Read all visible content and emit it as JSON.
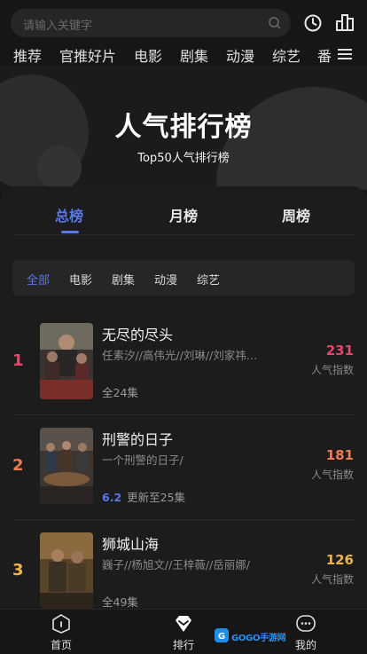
{
  "search": {
    "placeholder": "请输入关键字"
  },
  "nav": {
    "tabs": [
      "推荐",
      "官推好片",
      "电影",
      "剧集",
      "动漫",
      "综艺",
      "番"
    ]
  },
  "banner": {
    "title": "人气排行榜",
    "subtitle": "Top50人气排行榜"
  },
  "period_tabs": [
    "总榜",
    "月榜",
    "周榜"
  ],
  "filters": [
    "全部",
    "电影",
    "剧集",
    "动漫",
    "综艺"
  ],
  "rankings": [
    {
      "rank": "1",
      "title": "无尽的尽头",
      "cast": "任素汐//高伟光//刘琳//刘家祎…",
      "meta_score": "",
      "meta": "全24集",
      "popularity": "231",
      "popularity_label": "人气指数",
      "color": "#e4466e"
    },
    {
      "rank": "2",
      "title": "刑警的日子",
      "cast": "一个刑警的日子/",
      "meta_score": "6.2",
      "meta": "更新至25集",
      "popularity": "181",
      "popularity_label": "人气指数",
      "color": "#f07a52"
    },
    {
      "rank": "3",
      "title": "狮城山海",
      "cast": "巍子//杨旭文//王梓薇//岳丽娜/",
      "meta_score": "",
      "meta": "全49集",
      "popularity": "126",
      "popularity_label": "人气指数",
      "color": "#f2b24c"
    }
  ],
  "bottom_nav": [
    {
      "label": "首页",
      "icon": "home-icon"
    },
    {
      "label": "排行",
      "icon": "rank-diamond-icon"
    },
    {
      "label": "我的",
      "icon": "chat-face-icon"
    }
  ],
  "watermark": {
    "text": "GOGO手游网"
  },
  "colors": {
    "accent": "#5a78e6",
    "rank1": "#e4466e",
    "rank2": "#f07a52",
    "rank3": "#f2b24c"
  }
}
